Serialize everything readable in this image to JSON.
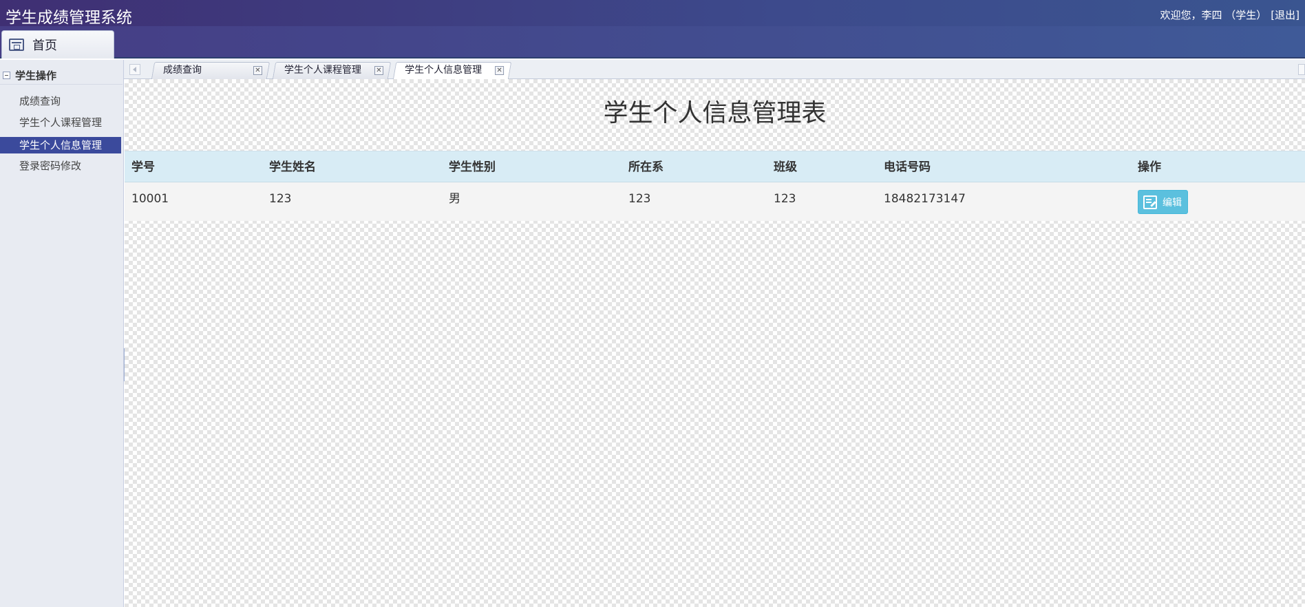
{
  "header": {
    "app_title": "学生成绩管理系统",
    "welcome": "欢迎您，李四 （学生）",
    "logout": "[退出]"
  },
  "nav": {
    "home_label": "首页"
  },
  "sidebar": {
    "group_label": "学生操作",
    "items": [
      {
        "label": "成绩查询"
      },
      {
        "label": "学生个人课程管理"
      },
      {
        "label": "学生个人信息管理"
      },
      {
        "label": "登录密码修改"
      }
    ],
    "active_index": 2
  },
  "tabs": [
    {
      "label": "成绩查询"
    },
    {
      "label": "学生个人课程管理"
    },
    {
      "label": "学生个人信息管理"
    }
  ],
  "main": {
    "page_title": "学生个人信息管理表",
    "columns": [
      "学号",
      "学生姓名",
      "学生性别",
      "所在系",
      "班级",
      "电话号码",
      "操作"
    ],
    "rows": [
      {
        "cells": [
          "10001",
          "123",
          "男",
          "123",
          "123",
          "18482173147"
        ],
        "action": "编辑"
      }
    ]
  },
  "colors": {
    "active_menu": "#3b4a9c",
    "header_row": "#d8ecf5",
    "edit_button": "#5bc0de"
  }
}
